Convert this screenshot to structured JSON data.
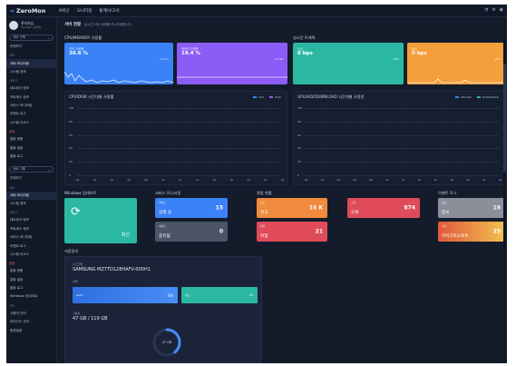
{
  "app": {
    "logo": "ZeroMon",
    "logo_mark": "≈"
  },
  "topbar": {
    "menu": [
      "서버군",
      "모니터링",
      "통계/보고서"
    ],
    "icons": [
      "bell-icon",
      "gear-icon",
      "user-icon"
    ]
  },
  "sidebar": {
    "user": {
      "name": "관리자님",
      "sub": "ZeroMon 관리자"
    },
    "filter1": "서버 선택",
    "sections": [
      {
        "head": "",
        "items": [
          "전체보기"
        ]
      },
      {
        "head": "서버",
        "items": [
          "서버 모니터링",
          "시스템 정보"
        ]
      },
      {
        "head": "서비스",
        "items": [
          "네트워크 정보",
          "프로세스 정보",
          "서비스 모니터링",
          "이벤트 로그",
          "시스템 리소스"
        ]
      },
      {
        "head": "알람",
        "red": true,
        "items": [
          "알람 현황",
          "알람 설정",
          "알람 로그"
        ]
      }
    ],
    "filter2": "서버 그룹",
    "sections2": [
      {
        "head": "",
        "items": [
          "전체보기"
        ]
      },
      {
        "head": "서버",
        "items": [
          "서버 모니터링",
          "시스템 정보"
        ]
      },
      {
        "head": "서비스",
        "items": [
          "네트워크 정보",
          "프로세스 정보",
          "서비스 모니터링",
          "이벤트 로그",
          "시스템 리소스"
        ]
      },
      {
        "head": "알람",
        "red": true,
        "items": [
          "알람 현황",
          "알람 설정",
          "알람 로그",
          "Windows 업데이트"
        ]
      },
      {
        "head": "기타",
        "items": [
          "사용자 관리",
          "라이선스 관리",
          "환경설정"
        ]
      }
    ]
  },
  "main": {
    "breadcrumb": "서버 현황",
    "breadcrumb_sub": "실시간 서버 상태를 모니터링합니다.",
    "usage_title": "CPU/MEMORY 사용률",
    "traffic_title": "실시간 트래픽",
    "cards": [
      {
        "label": "CPU 사용률",
        "value": "30.6 %",
        "meta": "4 Core",
        "color": "#3b82f6"
      },
      {
        "label": "메모리 사용률",
        "value": "19.4 %",
        "meta": "16 GB",
        "color": "#8b5cf6"
      },
      {
        "label": "수신",
        "value": "0 bps",
        "meta": "eth0",
        "color": "#2bb8a3"
      },
      {
        "label": "송신",
        "value": "0 bps",
        "meta": "eth0",
        "color": "#f59e3c"
      }
    ],
    "chart1": {
      "title": "CPU/DISK 시간대별 사용률",
      "legend": [
        "CPU",
        "DISK"
      ],
      "yticks": [
        "100",
        "80",
        "60",
        "40",
        "20",
        "0"
      ],
      "xticks": [
        "00",
        "02",
        "04",
        "06",
        "08",
        "10",
        "12",
        "14",
        "16",
        "18",
        "20",
        "22",
        "24"
      ]
    },
    "chart2": {
      "title": "UPLOAD/DOWNLOAD 시간대별 사용량",
      "legend": [
        "UPLOAD",
        "DOWNLOAD"
      ],
      "yticks": [
        "100",
        "80",
        "60",
        "40",
        "20",
        "0"
      ],
      "xticks": [
        "00",
        "02",
        "04",
        "06",
        "08",
        "10",
        "12",
        "14",
        "16",
        "18",
        "20",
        "22",
        "24"
      ]
    },
    "update": {
      "title": "Windows 업데이트",
      "status": "최신"
    },
    "process_title": "서비스 모니터링",
    "processes": [
      {
        "label": "서비스",
        "name": "실행 중",
        "value": "15",
        "color": "#3b82f6"
      },
      {
        "label": "서비스",
        "name": "중지됨",
        "value": "0",
        "color": "#4b5567"
      }
    ],
    "alarm_title": "알람 현황",
    "alarms": [
      {
        "label": "경고",
        "name": "경고",
        "value": "16 K",
        "color": "#f08a3c"
      },
      {
        "label": "오류",
        "name": "오류",
        "value": "874",
        "color": "#e04b5a"
      },
      {
        "label": "위험",
        "name": "위험",
        "value": "21",
        "color": "#e04b5a"
      }
    ],
    "event_title": "이벤트 로그",
    "events": [
      {
        "label": "정보",
        "name": "정보",
        "value": "19",
        "color": "#8a8f9a"
      },
      {
        "label": "기타",
        "name": "마이크로소프트",
        "value": "25",
        "color": "#f28a2e"
      }
    ],
    "storage_title": "저장장치",
    "storage": {
      "model_label": "디스크명",
      "model": "SAMSUNG MZ7TD128HAFV-000H1",
      "health_label": "상태",
      "bar1": {
        "label": "Good",
        "value": "정상"
      },
      "bar2": {
        "label": "온도",
        "value": "34"
      },
      "usage_label": "사용량",
      "usage": "47 GB / 119 GB",
      "ring_value": "47 GB",
      "ring_fraction": 0.39
    }
  }
}
